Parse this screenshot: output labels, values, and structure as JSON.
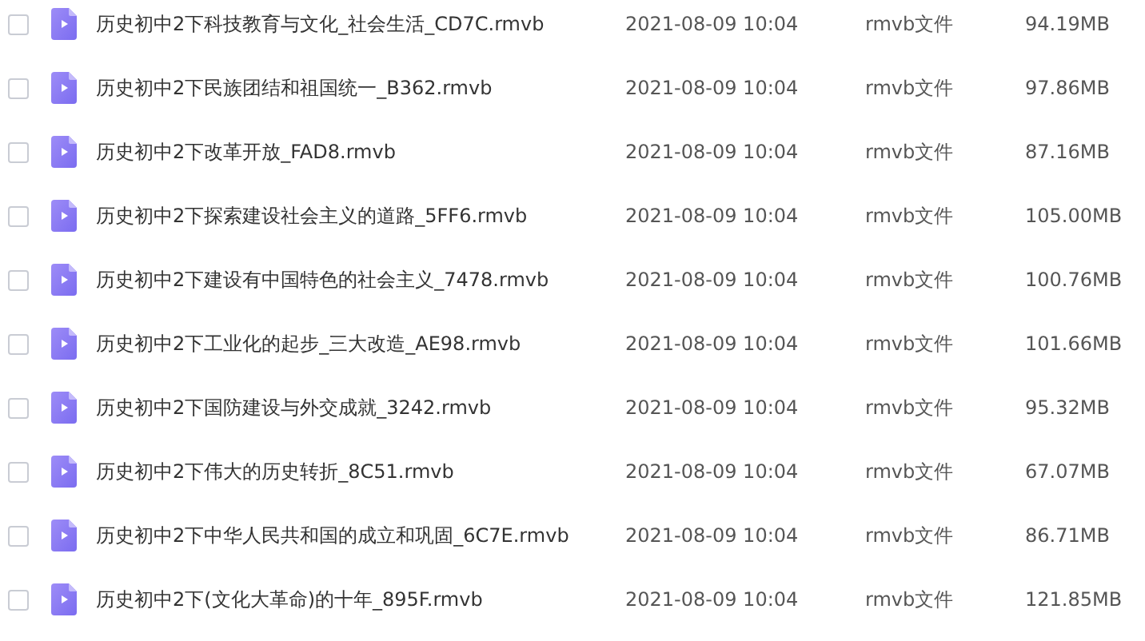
{
  "files": [
    {
      "name": "历史初中2下科技教育与文化_社会生活_CD7C.rmvb",
      "modified": "2021-08-09 10:04",
      "type": "rmvb文件",
      "size": "94.19MB",
      "checked": false
    },
    {
      "name": "历史初中2下民族团结和祖国统一_B362.rmvb",
      "modified": "2021-08-09 10:04",
      "type": "rmvb文件",
      "size": "97.86MB",
      "checked": false
    },
    {
      "name": "历史初中2下改革开放_FAD8.rmvb",
      "modified": "2021-08-09 10:04",
      "type": "rmvb文件",
      "size": "87.16MB",
      "checked": false
    },
    {
      "name": "历史初中2下探索建设社会主义的道路_5FF6.rmvb",
      "modified": "2021-08-09 10:04",
      "type": "rmvb文件",
      "size": "105.00MB",
      "checked": false
    },
    {
      "name": "历史初中2下建设有中国特色的社会主义_7478.rmvb",
      "modified": "2021-08-09 10:04",
      "type": "rmvb文件",
      "size": "100.76MB",
      "checked": false
    },
    {
      "name": "历史初中2下工业化的起步_三大改造_AE98.rmvb",
      "modified": "2021-08-09 10:04",
      "type": "rmvb文件",
      "size": "101.66MB",
      "checked": false
    },
    {
      "name": "历史初中2下国防建设与外交成就_3242.rmvb",
      "modified": "2021-08-09 10:04",
      "type": "rmvb文件",
      "size": "95.32MB",
      "checked": false
    },
    {
      "name": "历史初中2下伟大的历史转折_8C51.rmvb",
      "modified": "2021-08-09 10:04",
      "type": "rmvb文件",
      "size": "67.07MB",
      "checked": false
    },
    {
      "name": "历史初中2下中华人民共和国的成立和巩固_6C7E.rmvb",
      "modified": "2021-08-09 10:04",
      "type": "rmvb文件",
      "size": "86.71MB",
      "checked": false
    },
    {
      "name": "历史初中2下(文化大革命)的十年_895F.rmvb",
      "modified": "2021-08-09 10:04",
      "type": "rmvb文件",
      "size": "121.85MB",
      "checked": false
    }
  ]
}
